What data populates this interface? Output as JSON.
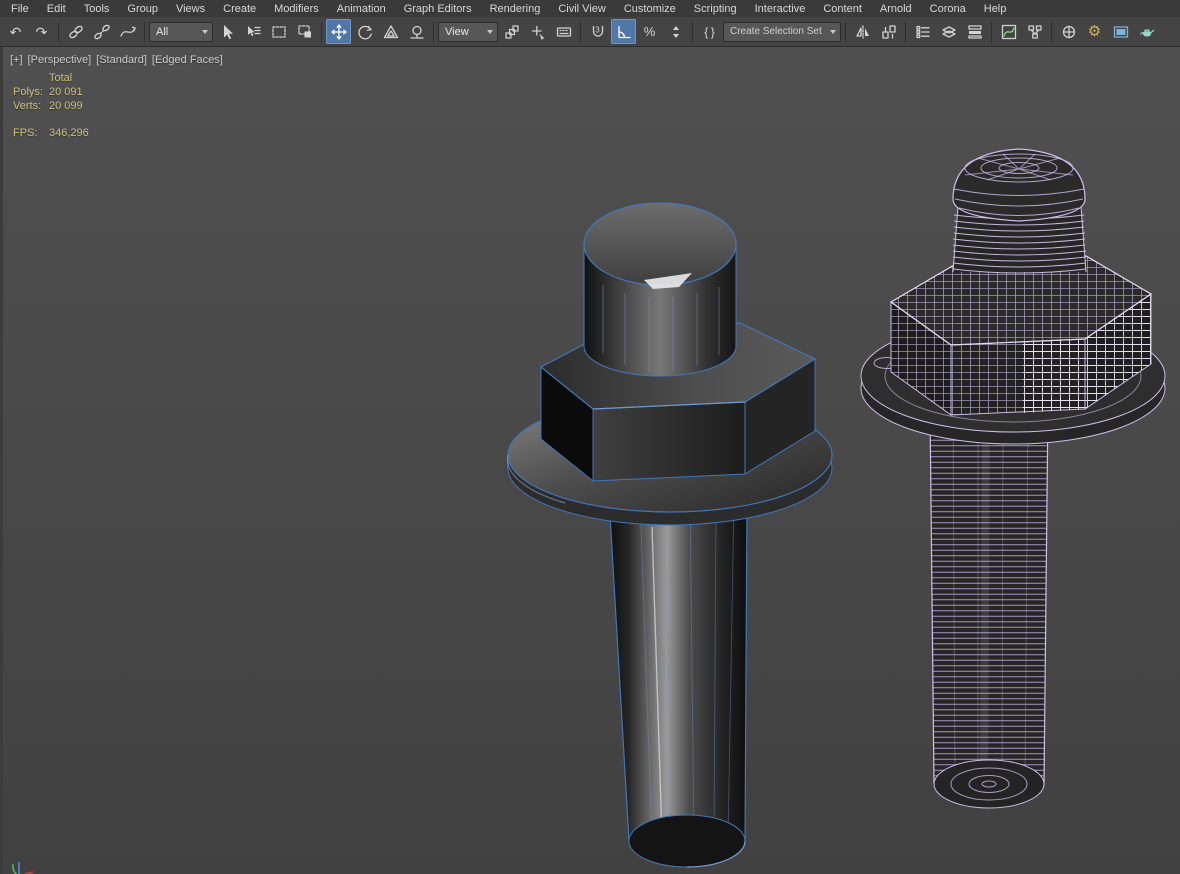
{
  "menu_bar": {
    "items": [
      "File",
      "Edit",
      "Tools",
      "Group",
      "Views",
      "Create",
      "Modifiers",
      "Animation",
      "Graph Editors",
      "Rendering",
      "Civil View",
      "Customize",
      "Scripting",
      "Interactive",
      "Content",
      "Arnold",
      "Corona",
      "Help"
    ]
  },
  "toolbar": {
    "selection_filter": {
      "value": "All"
    },
    "coordinate_system": {
      "value": "View"
    },
    "named_selection_sets": {
      "placeholder": "Create Selection Set"
    },
    "active_tools": [
      "select-and-move",
      "angle-snap-toggle"
    ],
    "tools": [
      "undo",
      "redo",
      "select-and-link",
      "unlink-selection",
      "bind-to-space-warp",
      "select-object",
      "select-by-name",
      "rectangular-selection-region",
      "window-crossing-toggle",
      "select-and-move",
      "select-and-rotate",
      "select-and-scale",
      "select-and-place",
      "use-pivot-point-center",
      "select-and-manipulate",
      "keyboard-shortcut-override-toggle",
      "snap-toggle-3d",
      "angle-snap-toggle",
      "percent-snap-toggle",
      "spinner-snap-toggle",
      "edit-named-selection-sets",
      "mirror",
      "align",
      "toggle-scene-explorer",
      "toggle-layer-explorer",
      "toggle-ribbon",
      "curve-editor",
      "schematic-view",
      "material-editor",
      "render-setup",
      "rendered-frame-window",
      "render-production"
    ]
  },
  "viewport": {
    "label": {
      "menu": "[+]",
      "point_of_view": "[Perspective]",
      "style": "[Standard]",
      "shading": "[Edged Faces]"
    },
    "statistics": {
      "total_header": "Total",
      "polys_label": "Polys:",
      "polys_value": "20 091",
      "verts_label": "Verts:",
      "verts_value": "20 099",
      "fps_label": "FPS:",
      "fps_value": "346,296"
    },
    "scene_objects": [
      "bolt-shaded-selected",
      "bolt-wireframe-selected"
    ]
  },
  "colors": {
    "selection_edge_blue": "#4276b8",
    "wireframe_purple": "#c9bce4",
    "stats_text": "#cdc17c",
    "active_tool_bg": "#5077a8",
    "viewport_bg_top": "#505050",
    "viewport_bg_bottom": "#414141"
  }
}
